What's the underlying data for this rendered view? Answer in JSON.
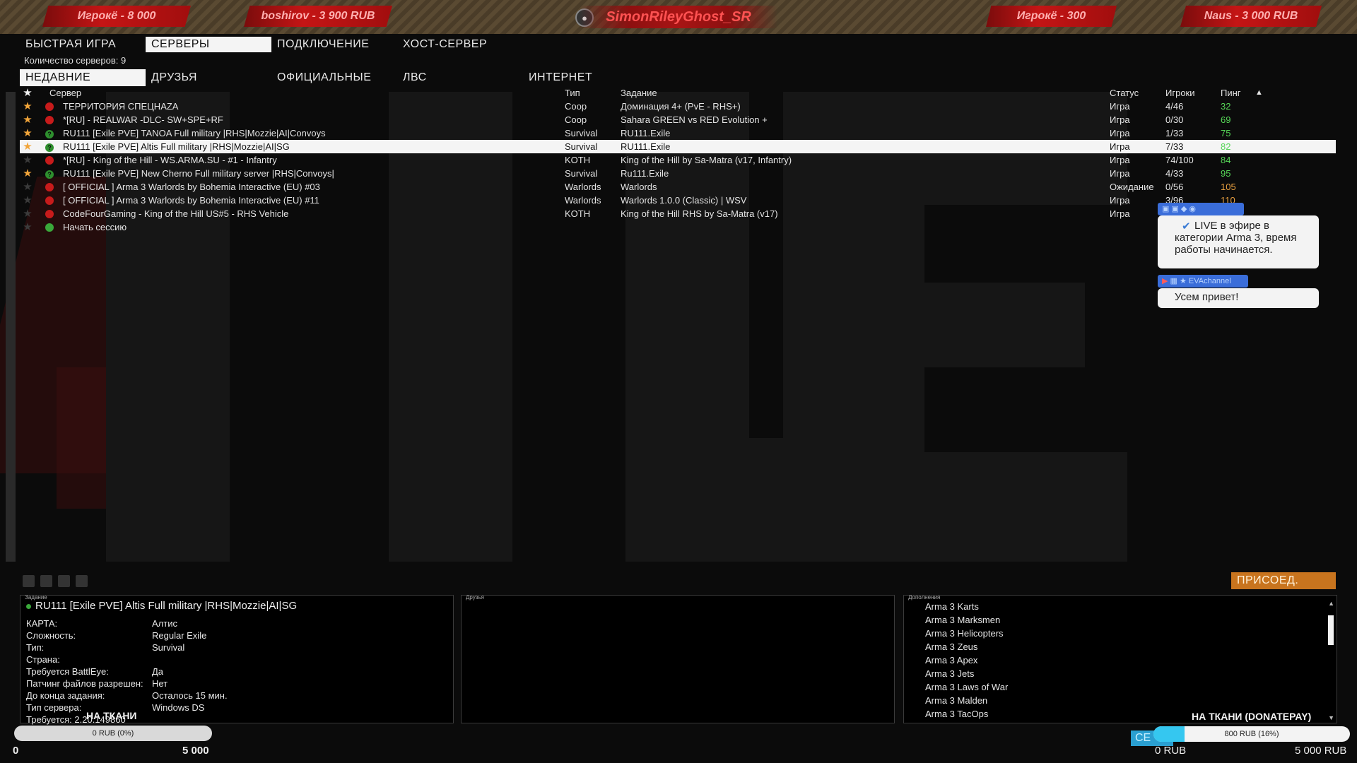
{
  "topbar": {
    "donors": [
      {
        "text": "Игрокё - 8 000",
        "icon": "star-icon"
      },
      {
        "text": "boshirov - 3 900 RUB",
        "icon": "star-icon"
      },
      {
        "text": "Игрокё - 300",
        "icon": "dollar-icon"
      },
      {
        "text": "Naus - 3 000 RUB",
        "icon": "dollar-icon"
      }
    ],
    "center_name": "SimonRileyGhost_SR"
  },
  "main_tabs": [
    "БЫСТРАЯ ИГРА",
    "СЕРВЕРЫ",
    "ПОДКЛЮЧЕНИЕ",
    "ХОСТ-СЕРВЕР"
  ],
  "active_main_tab": "СЕРВЕРЫ",
  "server_count": "Количество серверов: 9",
  "sub_tabs": [
    "НЕДАВНИЕ",
    "ДРУЗЬЯ",
    "ОФИЦИАЛЬНЫЕ",
    "ЛВС",
    "ИНТЕРНЕТ"
  ],
  "active_sub_tab": "НЕДАВНИЕ",
  "columns": {
    "server": "Сервер",
    "type": "Тип",
    "task": "Задание",
    "status": "Статус",
    "players": "Игроки",
    "ping": "Пинг"
  },
  "servers": [
    {
      "fav": true,
      "lock": "red",
      "name": "ТЕРРИТОРИЯ СПЕЦНАZA",
      "type": "Coop",
      "task": "Доминация 4+ (PvE - RHS+)",
      "status": "Игра",
      "players": "4/46",
      "ping": "32",
      "ping_color": "green"
    },
    {
      "fav": true,
      "lock": "red",
      "name": "*[RU] - REALWAR -DLC- SW+SPE+RF",
      "type": "Coop",
      "task": "Sahara GREEN vs RED Evolution +",
      "status": "Игра",
      "players": "0/30",
      "ping": "69",
      "ping_color": "green"
    },
    {
      "fav": true,
      "lock": "q",
      "name": "RU111 [Exile PVE] TANOA Full military |RHS|Mozzie|AI|Convoys",
      "type": "Survival",
      "task": "RU111.Exile",
      "status": "Игра",
      "players": "1/33",
      "ping": "75",
      "ping_color": "green"
    },
    {
      "fav": true,
      "lock": "q",
      "name": "RU111 [Exile PVE] Altis Full military |RHS|Mozzie|AI|SG",
      "type": "Survival",
      "task": "RU111.Exile",
      "status": "Игра",
      "players": "7/33",
      "ping": "82",
      "ping_color": "green",
      "selected": true
    },
    {
      "fav": false,
      "lock": "red",
      "name": " *[RU] - King of the Hill - WS.ARMA.SU - #1 - Infantry",
      "type": "KOTH",
      "task": "King of the Hill by Sa-Matra (v17, Infantry)",
      "status": "Игра",
      "players": "74/100",
      "ping": "84",
      "ping_color": "green"
    },
    {
      "fav": true,
      "lock": "q",
      "name": "RU111 [Exile PVE] New Cherno Full military server |RHS|Convoys|",
      "type": "Survival",
      "task": "Ru111.Exile",
      "status": "Игра",
      "players": "4/33",
      "ping": "95",
      "ping_color": "green"
    },
    {
      "fav": false,
      "lock": "red",
      "name": " [ OFFICIAL ] Arma 3 Warlords by Bohemia Interactive (EU) #03",
      "type": "Warlords",
      "task": "Warlords",
      "status": "Ожидание",
      "players": "0/56",
      "ping": "105",
      "ping_color": "orange"
    },
    {
      "fav": false,
      "lock": "red",
      "name": " [ OFFICIAL ] Arma 3 Warlords by Bohemia Interactive (EU) #11",
      "type": "Warlords",
      "task": "Warlords 1.0.0 (Classic) | WSV",
      "status": "Игра",
      "players": "3/96",
      "ping": "110",
      "ping_color": "orange"
    },
    {
      "fav": false,
      "lock": "red",
      "name": "CodeFourGaming - King of the Hill US#5 - RHS Vehicle",
      "type": "KOTH",
      "task": "King of the Hill RHS by Sa-Matra (v17)",
      "status": "Игра",
      "players": "",
      "ping": "",
      "ping_color": "green"
    },
    {
      "fav": false,
      "lock": "green",
      "name": "Начать сессию",
      "type": "",
      "task": "",
      "status": "",
      "players": "",
      "ping": "",
      "ping_color": "green"
    }
  ],
  "chat": {
    "message1": "LIVE в эфире в категории Arma 3, время работы начинается.",
    "user2": "EVAchannel",
    "message2": "Усем привет!"
  },
  "join_button": "ПРИСОЕД.",
  "details": {
    "panel_label": "Задание",
    "title": "RU111 [Exile PVE] Altis Full military |RHS|Mozzie|AI|SG",
    "rows": [
      {
        "k": "КАРТА:",
        "v": "Алтис"
      },
      {
        "k": "Сложность:",
        "v": "Regular Exile"
      },
      {
        "k": "Тип:",
        "v": "Survival"
      },
      {
        "k": "Страна:",
        "v": ""
      },
      {
        "k": "Требуется BattlEye:",
        "v": "Да"
      },
      {
        "k": "Патчинг файлов разрешен:",
        "v": "Нет"
      },
      {
        "k": "До конца задания:",
        "v": "Осталось 15 мин."
      },
      {
        "k": "Тип сервера:",
        "v": "Windows DS"
      },
      {
        "k": "Требуется: 2.20.149860",
        "v": ""
      }
    ]
  },
  "friends_panel_label": "Друзья",
  "addons": {
    "panel_label": "Дополнения",
    "items": [
      "Arma 3 Karts",
      "Arma 3 Marksmen",
      "Arma 3 Helicopters",
      "Arma 3 Zeus",
      "Arma 3 Apex",
      "Arma 3 Jets",
      "Arma 3 Laws of War",
      "Arma 3 Malden",
      "Arma 3 TacOps"
    ]
  },
  "goal_left": {
    "title": "НА ТКАНИ",
    "label": "0 RUB (0%)",
    "progress": 0,
    "min": "0",
    "max": "5 000"
  },
  "goal_right": {
    "title": "НА ТКАНИ (DONATEPAY)",
    "label": "800 RUB (16%)",
    "progress": 0.16,
    "min": "0 RUB",
    "max": "5 000 RUB"
  },
  "se_badge": "СЕ",
  "colors": {
    "accent": "#c8741e",
    "ping_green": "#56d657",
    "ping_orange": "#e8a040",
    "donor_red": "#c41515",
    "progress": "#35c7f0"
  }
}
